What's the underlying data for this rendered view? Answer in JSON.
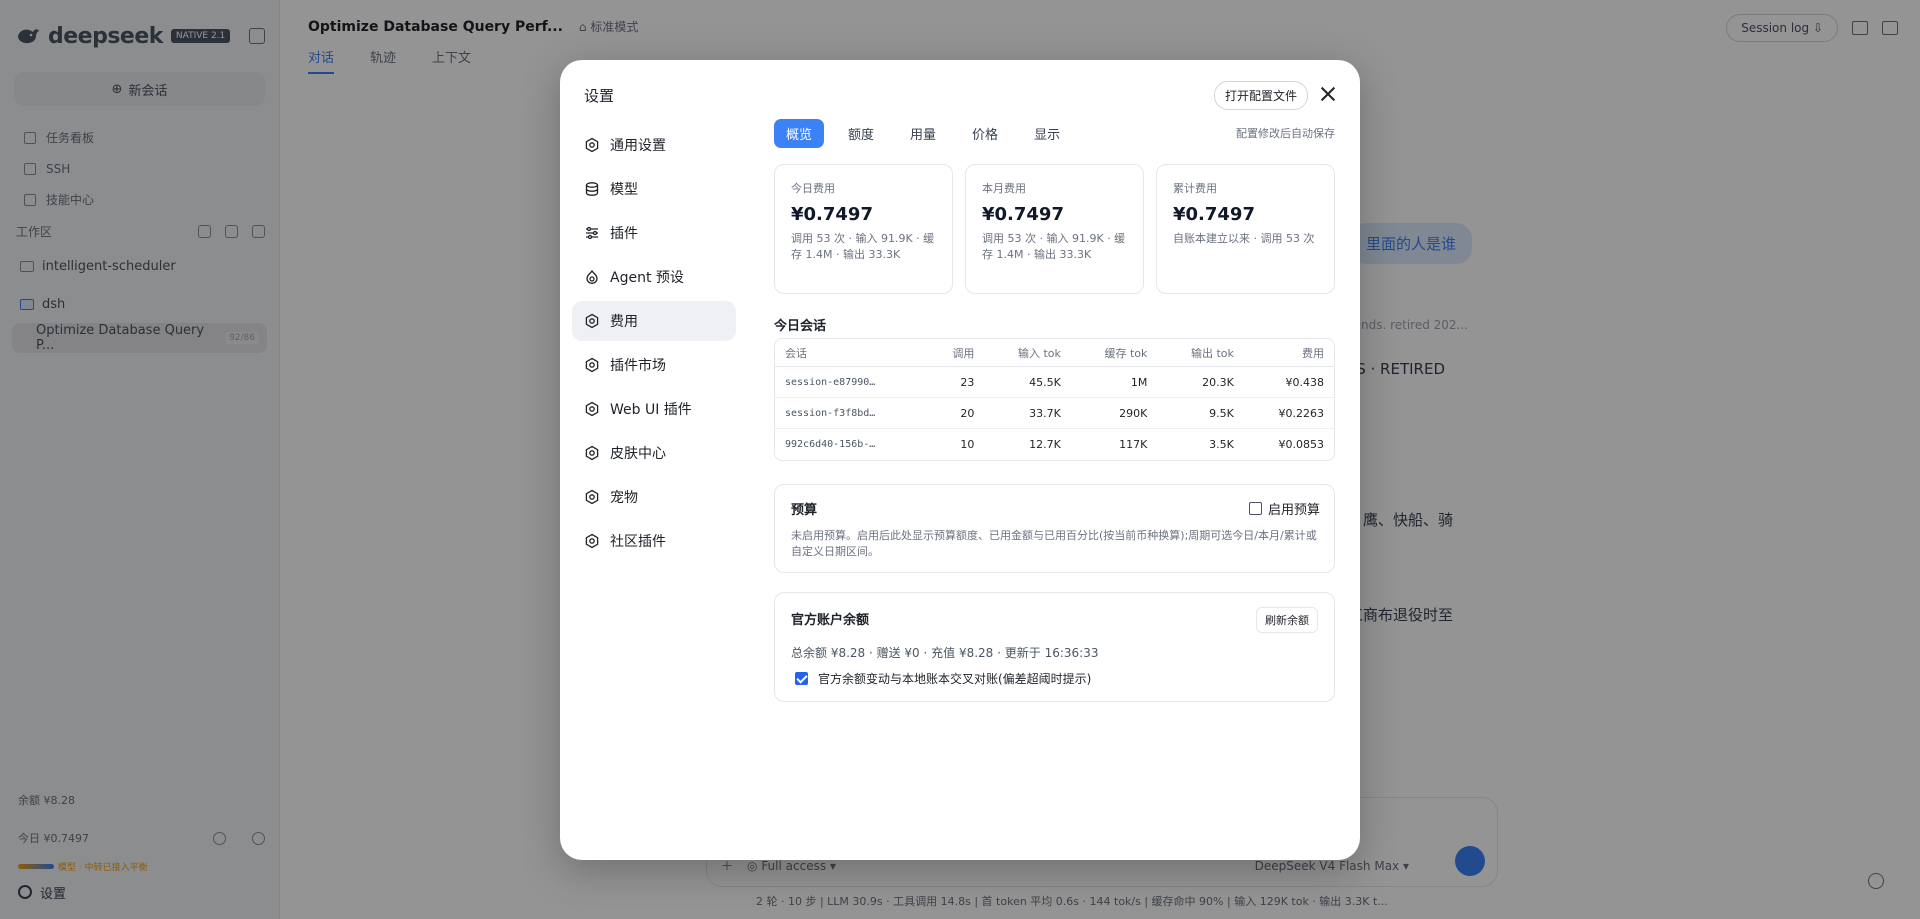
{
  "app": {
    "brand_name": "deepseek",
    "brand_badge": "NATIVE 2.1",
    "new_chat_label": "新会话",
    "side_links": [
      {
        "label": "任务看板",
        "icon": "board-icon"
      },
      {
        "label": "SSH",
        "icon": "terminal-icon"
      },
      {
        "label": "技能中心",
        "icon": "skills-icon"
      }
    ],
    "workspace_label": "工作区",
    "folders": [
      {
        "label": "intelligent-scheduler",
        "icon": "folder-icon"
      },
      {
        "label": "dsh",
        "icon": "folder-open-icon"
      }
    ],
    "active_session": {
      "title": "Optimize Database Query P...",
      "count": "92/86"
    },
    "footer": {
      "balance": "余额 ¥8.28",
      "today": "今日 ¥0.7497",
      "warning": "模型 · 中转已接入平衡",
      "settings_label": "设置"
    },
    "topbar": {
      "title": "Optimize Database Query Perf...",
      "mode": "标准模式",
      "tabs": [
        "对话",
        "轨迹",
        "上下文"
      ],
      "session_log": "Session log"
    },
    "bg_chip": "里面的人是谁",
    "bg_snippets": [
      "...ends. retired 202...",
      "S · RETIRED",
      "鹰、快船、骑",
      "工商布退役时至"
    ],
    "composer": {
      "access": "Full access",
      "model": "DeepSeek V4 Flash",
      "effort": "Max"
    },
    "status_line": "2 轮 · 10 步 | LLM 30.9s · 工具调用 14.8s | 首 token 平均 0.6s · 144 tok/s | 缓存命中 90% | 输入 129K tok · 输出 3.3K t..."
  },
  "modal": {
    "title": "设置",
    "open_config_label": "打开配置文件",
    "menu": [
      {
        "label": "通用设置",
        "icon": "gear-icon"
      },
      {
        "label": "模型",
        "icon": "database-icon"
      },
      {
        "label": "插件",
        "icon": "sliders-icon"
      },
      {
        "label": "Agent 预设",
        "icon": "agent-icon"
      },
      {
        "label": "费用",
        "icon": "gear-icon"
      },
      {
        "label": "插件市场",
        "icon": "gear-icon"
      },
      {
        "label": "Web UI 插件",
        "icon": "gear-icon"
      },
      {
        "label": "皮肤中心",
        "icon": "gear-icon"
      },
      {
        "label": "宠物",
        "icon": "gear-icon"
      },
      {
        "label": "社区插件",
        "icon": "gear-icon"
      }
    ],
    "active_menu": "费用",
    "subtabs": [
      "概览",
      "额度",
      "用量",
      "价格",
      "显示"
    ],
    "active_subtab": "概览",
    "autosave_note": "配置修改后自动保存",
    "cost_cards": [
      {
        "label": "今日费用",
        "amount": "¥0.7497",
        "desc": "调用 53 次 · 输入 91.9K · 缓存 1.4M · 输出 33.3K"
      },
      {
        "label": "本月费用",
        "amount": "¥0.7497",
        "desc": "调用 53 次 · 输入 91.9K · 缓存 1.4M · 输出 33.3K"
      },
      {
        "label": "累计费用",
        "amount": "¥0.7497",
        "desc": "自账本建立以来 · 调用 53 次"
      }
    ],
    "today_sessions": {
      "title": "今日会话",
      "headers": [
        "会话",
        "调用",
        "输入 tok",
        "缓存 tok",
        "输出 tok",
        "费用"
      ],
      "rows": [
        [
          "session-e87990…",
          "23",
          "45.5K",
          "1M",
          "20.3K",
          "¥0.438"
        ],
        [
          "session-f3f8bd…",
          "20",
          "33.7K",
          "290K",
          "9.5K",
          "¥0.2263"
        ],
        [
          "992c6d40-156b-…",
          "10",
          "12.7K",
          "117K",
          "3.5K",
          "¥0.0853"
        ]
      ]
    },
    "budget": {
      "title": "预算",
      "enable_label": "启用预算",
      "enabled": false,
      "desc": "未启用预算。启用后此处显示预算额度、已用金额与已用百分比(按当前币种换算);周期可选今日/本月/累计或自定义日期区间。"
    },
    "account": {
      "title": "官方账户余额",
      "refresh_label": "刷新余额",
      "summary": "总余额 ¥8.28 · 赠送 ¥0 · 充值 ¥8.28 · 更新于 16:36:33",
      "reconcile_label": "官方余额变动与本地账本交叉对账(偏差超阈时提示)",
      "reconcile_checked": true
    }
  }
}
